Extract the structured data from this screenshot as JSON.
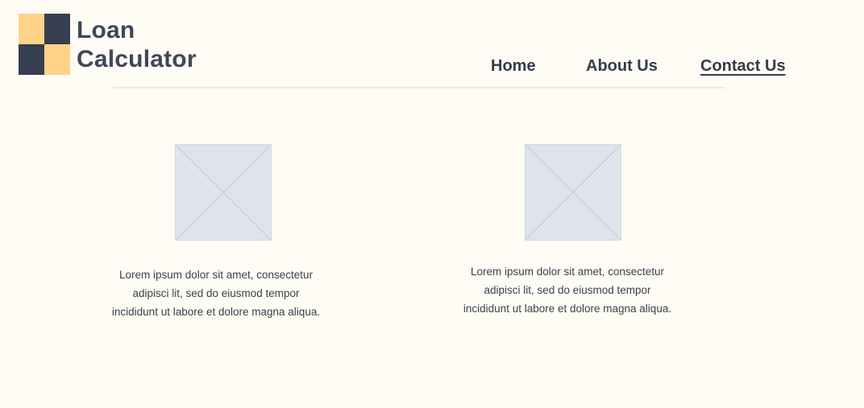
{
  "brand": {
    "line1": "Loan",
    "line2": "Calculator"
  },
  "nav": {
    "home": "Home",
    "about": "About Us",
    "contact": "Contact Us"
  },
  "cards": [
    {
      "text": "Lorem ipsum dolor sit amet, consectetur adipisci lit, sed do eiusmod tempor incididunt ut labore et dolore magna aliqua."
    },
    {
      "text": "Lorem ipsum dolor sit amet, consectetur adipisci lit, sed do eiusmod tempor incididunt ut labore et dolore magna aliqua."
    }
  ],
  "colors": {
    "background": "#fffbf5",
    "logo_light": "#ffd387",
    "logo_dark": "#363f4f",
    "text": "#3f4654",
    "placeholder": "#dfe4ec"
  }
}
